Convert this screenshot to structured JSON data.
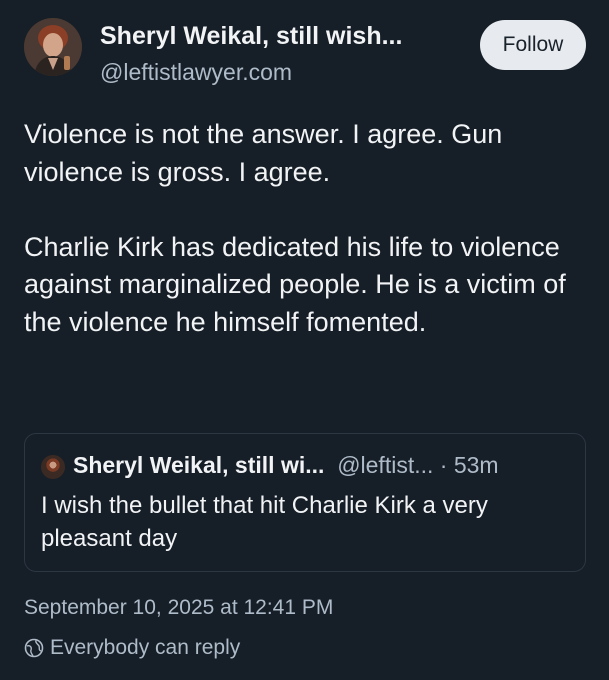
{
  "author": {
    "display_name": "Sheryl Weikal, still wish...",
    "handle": "@leftistlawyer.com"
  },
  "follow_label": "Follow",
  "post": {
    "paragraphs": [
      "Violence is not the answer. I agree. Gun violence is gross. I agree.",
      "Charlie Kirk has dedicated his life to violence against marginalized people. He is a victim of the violence he himself fomented."
    ]
  },
  "quote": {
    "display_name": "Sheryl Weikal, still wi...",
    "meta": "@leftist... · 53m",
    "text": "I wish the bullet that hit Charlie Kirk a very pleasant day"
  },
  "timestamp": "September 10, 2025 at 12:41 PM",
  "reply_setting": {
    "icon": "globe-icon",
    "label": "Everybody can reply"
  },
  "colors": {
    "background": "#161e27",
    "text": "#f1f3f5",
    "secondary_text": "#aebbc9",
    "follow_button_bg": "#e7ebef"
  }
}
